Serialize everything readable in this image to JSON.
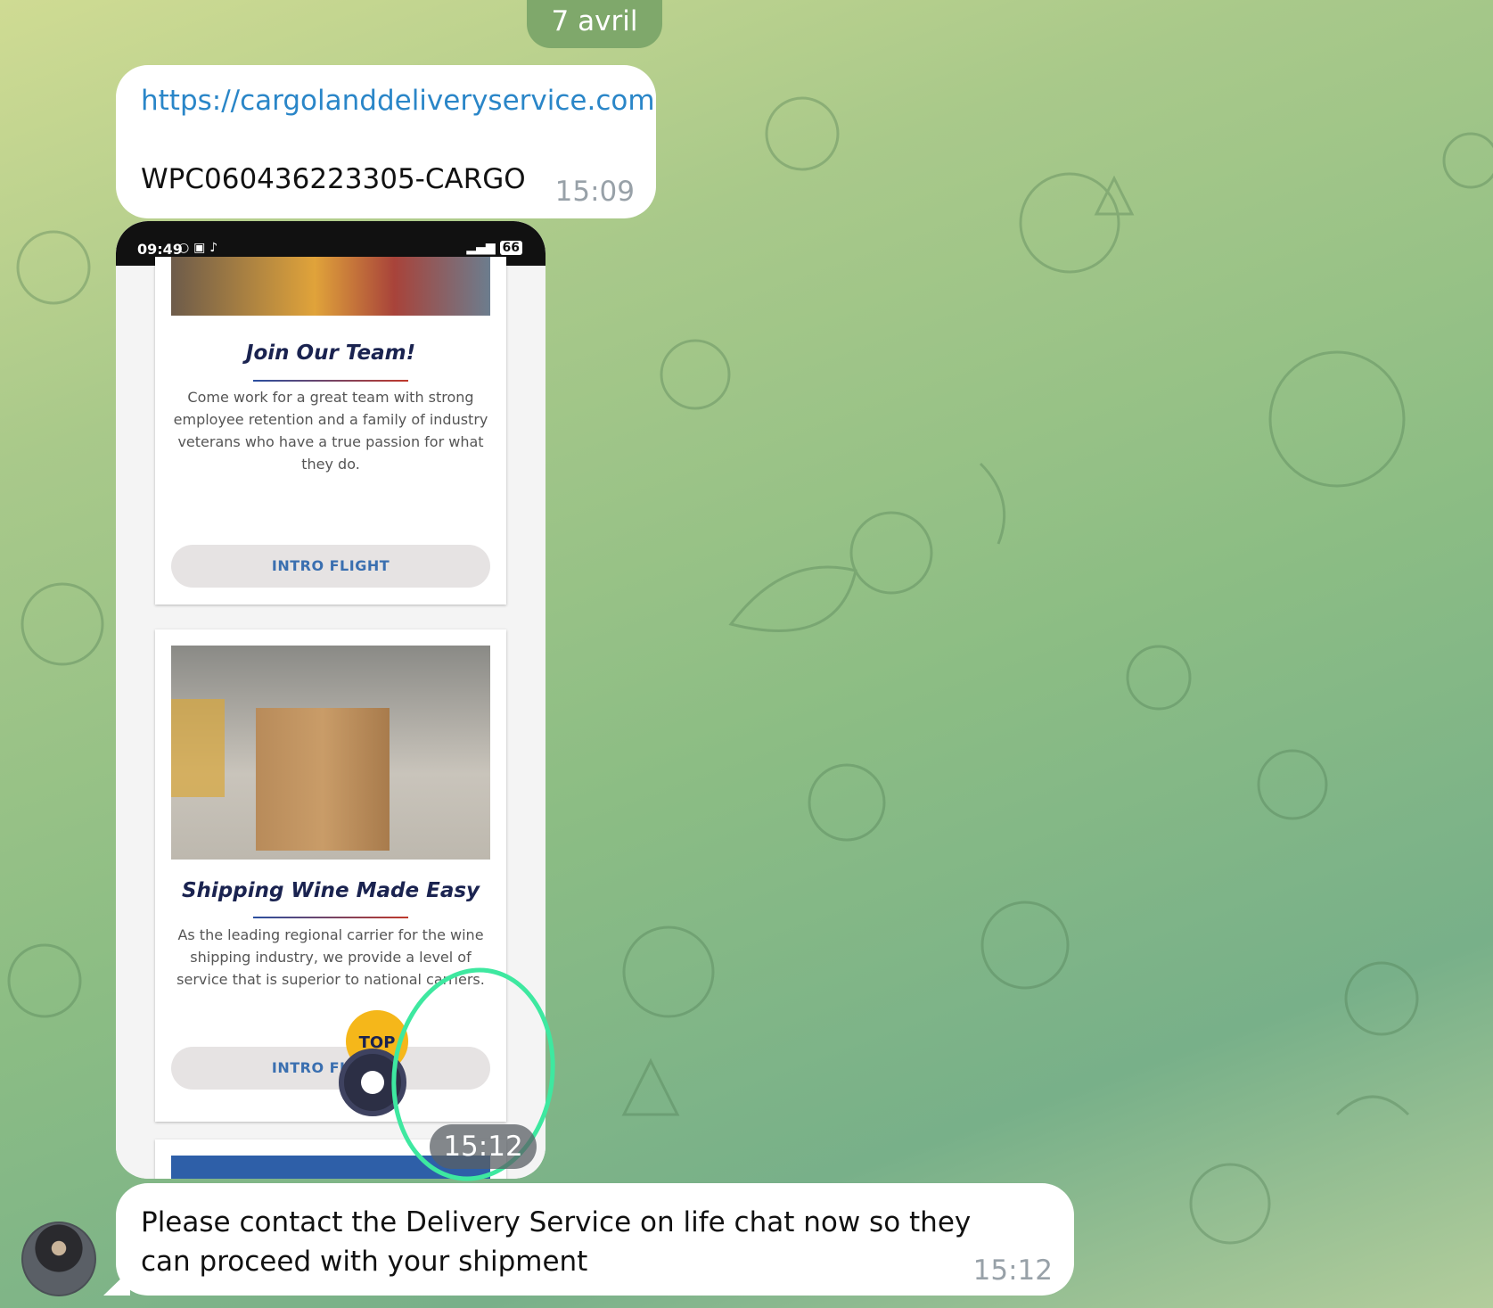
{
  "date_separator": "7 avril",
  "messages": [
    {
      "link": "https://cargolanddeliveryservice.com",
      "code": "WPC060436223305-CARGO",
      "time": "15:09"
    },
    {
      "screenshot": {
        "status_time": "09:49",
        "status_icons": "○ ▣ ♪",
        "battery": "66",
        "cards": [
          {
            "title": "Join Our Team!",
            "body": "Come work for a great team with strong employee retention and a family of industry veterans who have a true passion for what they do.",
            "button": "INTRO FLIGHT"
          },
          {
            "title": "Shipping Wine Made Easy",
            "body": "As the leading regional carrier for the wine shipping industry, we provide a level of service that is superior to national carriers.",
            "button": "INTRO FLIGHT"
          }
        ],
        "top_button": "TOP"
      },
      "time": "15:12"
    },
    {
      "text": "Please contact the Delivery Service on life chat now so they can proceed with your shipment",
      "time": "15:12"
    }
  ],
  "colors": {
    "link": "#2a86c8",
    "date_pill": "#7fa86b",
    "highlight_circle": "#3ee8a0",
    "top_button": "#f5b71a"
  }
}
